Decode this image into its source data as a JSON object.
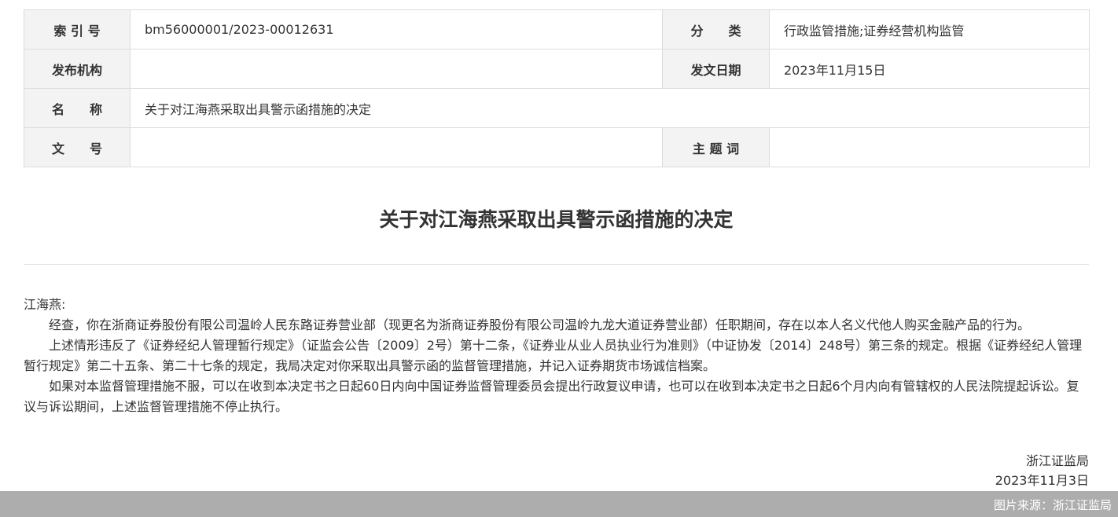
{
  "meta": {
    "index_label": "索 引 号",
    "index_value": "bm56000001/2023-00012631",
    "category_label": "分　　类",
    "category_value": "行政监管措施;证券经营机构监管",
    "issuer_label": "发布机构",
    "issuer_value": "",
    "date_label": "发文日期",
    "date_value": "2023年11月15日",
    "name_label": "名　　称",
    "name_value": "关于对江海燕采取出具警示函措施的决定",
    "docno_label": "文　　号",
    "docno_value": "",
    "subject_label": "主 题 词",
    "subject_value": ""
  },
  "document": {
    "title": "关于对江海燕采取出具警示函措施的决定",
    "salutation": "江海燕:",
    "paragraphs": [
      "经查，你在浙商证券股份有限公司温岭人民东路证券营业部（现更名为浙商证券股份有限公司温岭九龙大道证券营业部）任职期间，存在以本人名义代他人购买金融产品的行为。",
      "上述情形违反了《证券经纪人管理暂行规定》（证监会公告〔2009〕2号）第十二条，《证券业从业人员执业行为准则》（中证协发〔2014〕248号）第三条的规定。根据《证券经纪人管理暂行规定》第二十五条、第二十七条的规定，我局决定对你采取出具警示函的监督管理措施，并记入证券期货市场诚信档案。",
      "如果对本监督管理措施不服，可以在收到本决定书之日起60日内向中国证券监督管理委员会提出行政复议申请，也可以在收到本决定书之日起6个月内向有管辖权的人民法院提起诉讼。复议与诉讼期间，上述监督管理措施不停止执行。"
    ],
    "signer": "浙江证监局",
    "sign_date": "2023年11月3日"
  },
  "footer": {
    "source": "图片来源：浙江证监局"
  }
}
